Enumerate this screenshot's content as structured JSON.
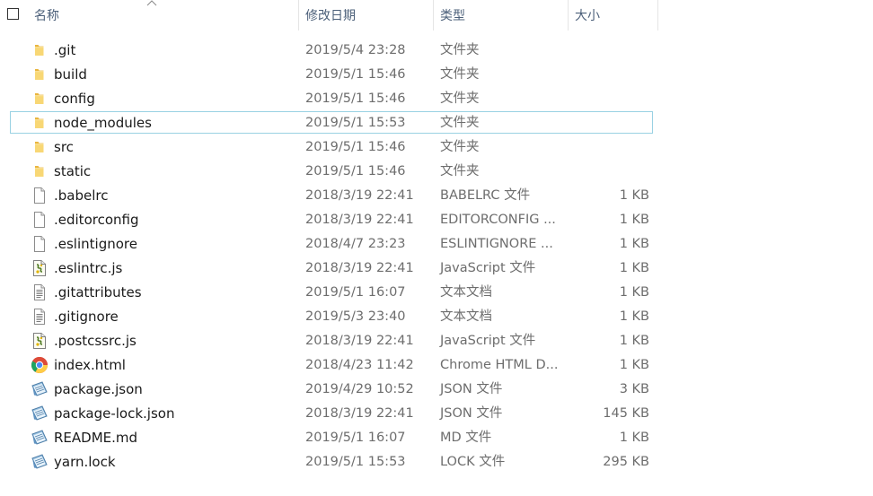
{
  "header": {
    "name": "名称",
    "date": "修改日期",
    "type": "类型",
    "size": "大小"
  },
  "files": [
    {
      "name": ".git",
      "date": "2019/5/4 23:28",
      "type": "文件夹",
      "size": "",
      "icon": "folder-icon"
    },
    {
      "name": "build",
      "date": "2019/5/1 15:46",
      "type": "文件夹",
      "size": "",
      "icon": "folder-icon"
    },
    {
      "name": "config",
      "date": "2019/5/1 15:46",
      "type": "文件夹",
      "size": "",
      "icon": "folder-icon"
    },
    {
      "name": "node_modules",
      "date": "2019/5/1 15:53",
      "type": "文件夹",
      "size": "",
      "icon": "folder-icon",
      "focused": true
    },
    {
      "name": "src",
      "date": "2019/5/1 15:46",
      "type": "文件夹",
      "size": "",
      "icon": "folder-icon"
    },
    {
      "name": "static",
      "date": "2019/5/1 15:46",
      "type": "文件夹",
      "size": "",
      "icon": "folder-icon"
    },
    {
      "name": ".babelrc",
      "date": "2018/3/19 22:41",
      "type": "BABELRC 文件",
      "size": "1 KB",
      "icon": "blank-file-icon"
    },
    {
      "name": ".editorconfig",
      "date": "2018/3/19 22:41",
      "type": "EDITORCONFIG ...",
      "size": "1 KB",
      "icon": "blank-file-icon"
    },
    {
      "name": ".eslintignore",
      "date": "2018/4/7 23:23",
      "type": "ESLINTIGNORE ...",
      "size": "1 KB",
      "icon": "blank-file-icon"
    },
    {
      "name": ".eslintrc.js",
      "date": "2018/3/19 22:41",
      "type": "JavaScript 文件",
      "size": "1 KB",
      "icon": "javascript-file-icon"
    },
    {
      "name": ".gitattributes",
      "date": "2019/5/1 16:07",
      "type": "文本文档",
      "size": "1 KB",
      "icon": "text-file-icon"
    },
    {
      "name": ".gitignore",
      "date": "2019/5/3 23:40",
      "type": "文本文档",
      "size": "1 KB",
      "icon": "text-file-icon"
    },
    {
      "name": ".postcssrc.js",
      "date": "2018/3/19 22:41",
      "type": "JavaScript 文件",
      "size": "1 KB",
      "icon": "javascript-file-icon"
    },
    {
      "name": "index.html",
      "date": "2018/4/23 11:42",
      "type": "Chrome HTML D...",
      "size": "1 KB",
      "icon": "chrome-icon"
    },
    {
      "name": "package.json",
      "date": "2019/4/29 10:52",
      "type": "JSON 文件",
      "size": "3 KB",
      "icon": "notepad-file-icon"
    },
    {
      "name": "package-lock.json",
      "date": "2018/3/19 22:41",
      "type": "JSON 文件",
      "size": "145 KB",
      "icon": "notepad-file-icon"
    },
    {
      "name": "README.md",
      "date": "2019/5/1 16:07",
      "type": "MD 文件",
      "size": "1 KB",
      "icon": "notepad-file-icon"
    },
    {
      "name": "yarn.lock",
      "date": "2019/5/1 15:53",
      "type": "LOCK 文件",
      "size": "295 KB",
      "icon": "notepad-file-icon"
    }
  ],
  "colors": {
    "header_text": "#4c607a",
    "focus_border": "#99d1e3",
    "folder": "#f8d775",
    "secondary_text": "#6d6d6d"
  }
}
